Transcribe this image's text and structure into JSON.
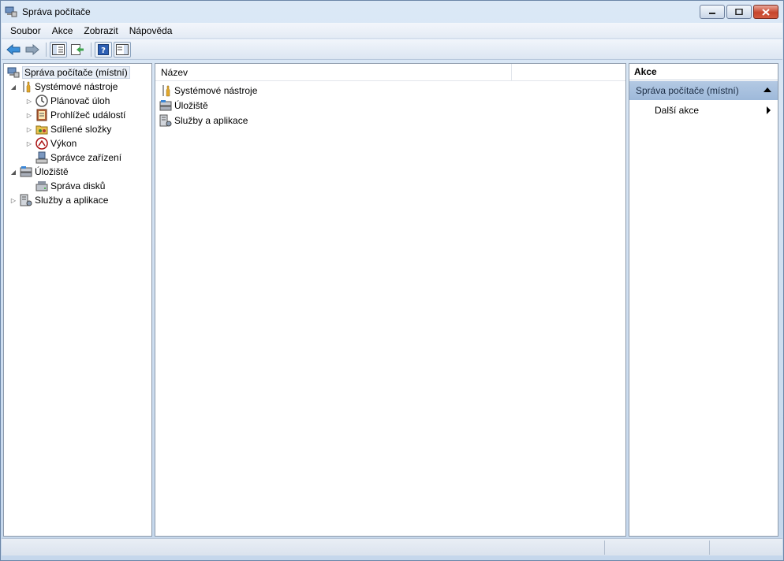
{
  "window": {
    "title": "Správa počítače",
    "title_icon": "computer-management-icon"
  },
  "menu": {
    "items": [
      "Soubor",
      "Akce",
      "Zobrazit",
      "Nápověda"
    ]
  },
  "toolbar": {
    "buttons": [
      "back-arrow-icon",
      "forward-arrow-icon",
      "show-hide-tree-icon",
      "export-list-icon",
      "help-icon",
      "show-hide-action-pane-icon"
    ]
  },
  "tree": {
    "root": "Správa počítače (místní)",
    "system_tools": "Systémové nástroje",
    "task_scheduler": "Plánovač úloh",
    "event_viewer": "Prohlížeč událostí",
    "shared_folders": "Sdílené složky",
    "performance": "Výkon",
    "device_manager": "Správce zařízení",
    "storage": "Úložiště",
    "disk_management": "Správa disků",
    "services_apps": "Služby a aplikace"
  },
  "list": {
    "column_name": "Název",
    "rows": [
      "Systémové nástroje",
      "Úložiště",
      "Služby a aplikace"
    ]
  },
  "actions": {
    "header": "Akce",
    "group": "Správa počítače (místní)",
    "more": "Další akce"
  },
  "colors": {
    "accent": "#9eb9da",
    "chrome": "#cfdff0"
  }
}
